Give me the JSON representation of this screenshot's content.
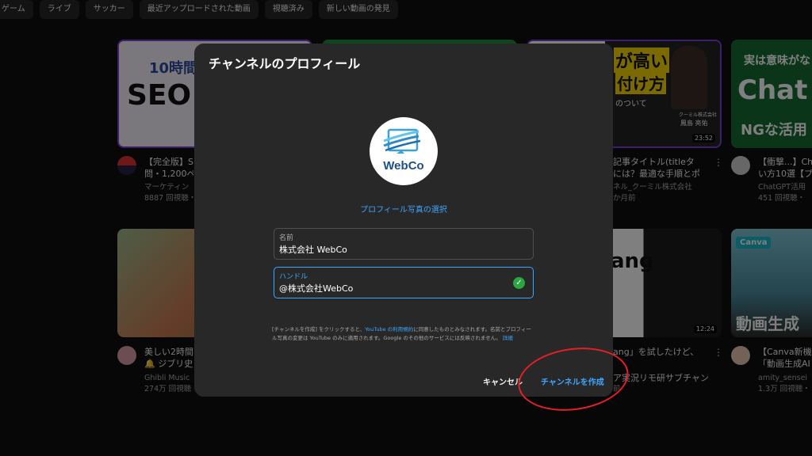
{
  "chips": [
    "ゲーム",
    "ライブ",
    "サッカー",
    "最近アップロードされた動画",
    "視聴済み",
    "新しい動画の発見"
  ],
  "videos": [
    {
      "title1": "【完全版】S",
      "title2": "問・1,200ペ",
      "channel": "マーケティン",
      "meta": "8887 回視聴・",
      "thumb_text1": "10時間",
      "thumb_text2": "SEO"
    },
    {
      "title1": "記事タイトル(titleタ",
      "title2": "には？最適な手順とポ",
      "channel": "ネル_クーミル株式会社",
      "meta": "か月前",
      "thumb_text1": "が高い",
      "thumb_text2": "付け方",
      "thumb_text3": "のついて",
      "thumb_text4": "クーミル株式会社",
      "thumb_text5": "鳳島 亮佑",
      "duration": "23:52"
    },
    {
      "title1": "【衝撃...】Ch",
      "title2": "い方10選【プ",
      "channel": "ChatGPT活用",
      "meta": "451 回視聴・",
      "thumb_text1": "実は意味がな",
      "thumb_text2": "Chat",
      "thumb_text3": "NGな活用"
    },
    {
      "title1": "美しい2時間",
      "title2": "🔔 ジブリ史",
      "channel": "Ghibli Music",
      "meta": "274万 回視聴"
    },
    {
      "title1": "ang」を試したけど、",
      "title2": "ア実況リモ研サブチャン",
      "channel": "",
      "meta": "前",
      "thumb_text1": "ang",
      "duration": "12:24"
    },
    {
      "title1": "【Canva新機",
      "title2": "「動画生成AI",
      "channel": "amity_sensei",
      "meta": "1.3万 回視聴・",
      "thumb_text1": "Canva",
      "thumb_text2": "動画生成"
    }
  ],
  "dialog": {
    "title": "チャンネルのプロフィール",
    "logo_text": "WebCo",
    "photo_link": "プロフィール写真の選択",
    "name_label": "名前",
    "name_value": "株式会社 WebCo",
    "handle_label": "ハンドル",
    "handle_value": "@株式会社WebCo",
    "terms_1": "[チャンネルを作成] をクリックすると、",
    "terms_link": "YouTube の利用規約",
    "terms_2": "に同意したものとみなされます。名前とプロフィール写真の変更は YouTube のみに適用されます。Google のその他のサービスには反映されません。",
    "terms_more": "詳細",
    "cancel": "キャンセル",
    "create": "チャンネルを作成"
  },
  "colors": {
    "accent": "#3ea6ff",
    "success": "#2ba640",
    "annotation": "#e41f26"
  }
}
